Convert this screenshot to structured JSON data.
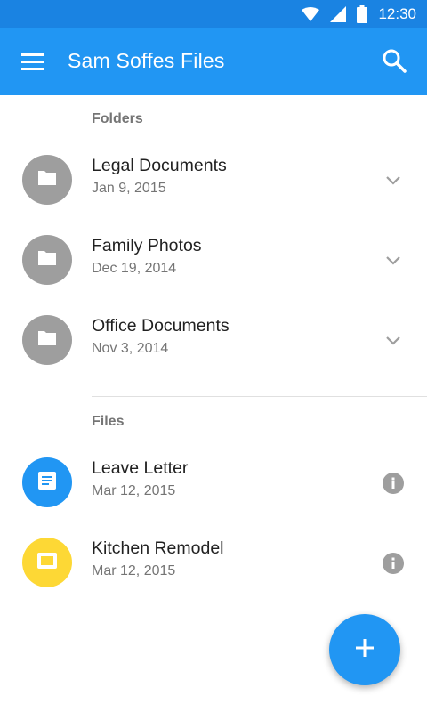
{
  "status_bar": {
    "time": "12:30"
  },
  "app_bar": {
    "title": "Sam Soffes Files"
  },
  "sections": {
    "folders_label": "Folders",
    "files_label": "Files"
  },
  "folders": [
    {
      "name": "Legal Documents",
      "date": "Jan 9, 2015",
      "icon": "folder-icon"
    },
    {
      "name": "Family Photos",
      "date": "Dec 19, 2014",
      "icon": "folder-icon"
    },
    {
      "name": "Office Documents",
      "date": "Nov 3, 2014",
      "icon": "folder-icon"
    }
  ],
  "files": [
    {
      "name": "Leave Letter",
      "date": "Mar 12, 2015",
      "icon": "document-icon",
      "color": "#2196f3"
    },
    {
      "name": "Kitchen Remodel",
      "date": "Mar 12, 2015",
      "icon": "slides-icon",
      "color": "#fdd835"
    }
  ],
  "colors": {
    "primary": "#2196f3",
    "status_bar": "#1a83e2",
    "folder_avatar": "#9e9e9e"
  }
}
